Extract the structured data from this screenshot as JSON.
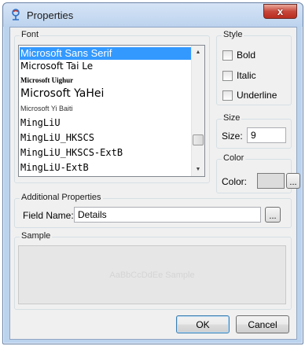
{
  "window": {
    "title": "Properties",
    "close_glyph": "x"
  },
  "font_group": {
    "label": "Font",
    "items": [
      {
        "label": "Microsoft Sans Serif",
        "selected": true
      },
      {
        "label": "Microsoft Tai Le",
        "selected": false
      },
      {
        "label": "Microsoft Uighur",
        "selected": false
      },
      {
        "label": "Microsoft YaHei",
        "selected": false
      },
      {
        "label": "Microsoft Yi Baiti",
        "selected": false
      },
      {
        "label": "MingLiU",
        "selected": false
      },
      {
        "label": "MingLiU_HKSCS",
        "selected": false
      },
      {
        "label": "MingLiU_HKSCS-ExtB",
        "selected": false
      },
      {
        "label": "MingLiU-ExtB",
        "selected": false
      }
    ]
  },
  "style_group": {
    "label": "Style",
    "bold_label": "Bold",
    "italic_label": "Italic",
    "underline_label": "Underline"
  },
  "size_group": {
    "label": "Size",
    "field_label": "Size:",
    "value": "9"
  },
  "color_group": {
    "label": "Color",
    "field_label": "Color:",
    "swatch_color": "#dcdcdc",
    "browse_label": "..."
  },
  "additional_group": {
    "label": "Additional Properties",
    "field_label": "Field Name:",
    "field_value": "Details",
    "browse_label": "..."
  },
  "sample_group": {
    "label": "Sample",
    "sample_text": "AaBbCcDdEe Sample"
  },
  "buttons": {
    "ok_label": "OK",
    "cancel_label": "Cancel"
  },
  "colors": {
    "selection": "#3399ff",
    "title_bar": "#bcd3ee",
    "close_button": "#c7463a"
  }
}
